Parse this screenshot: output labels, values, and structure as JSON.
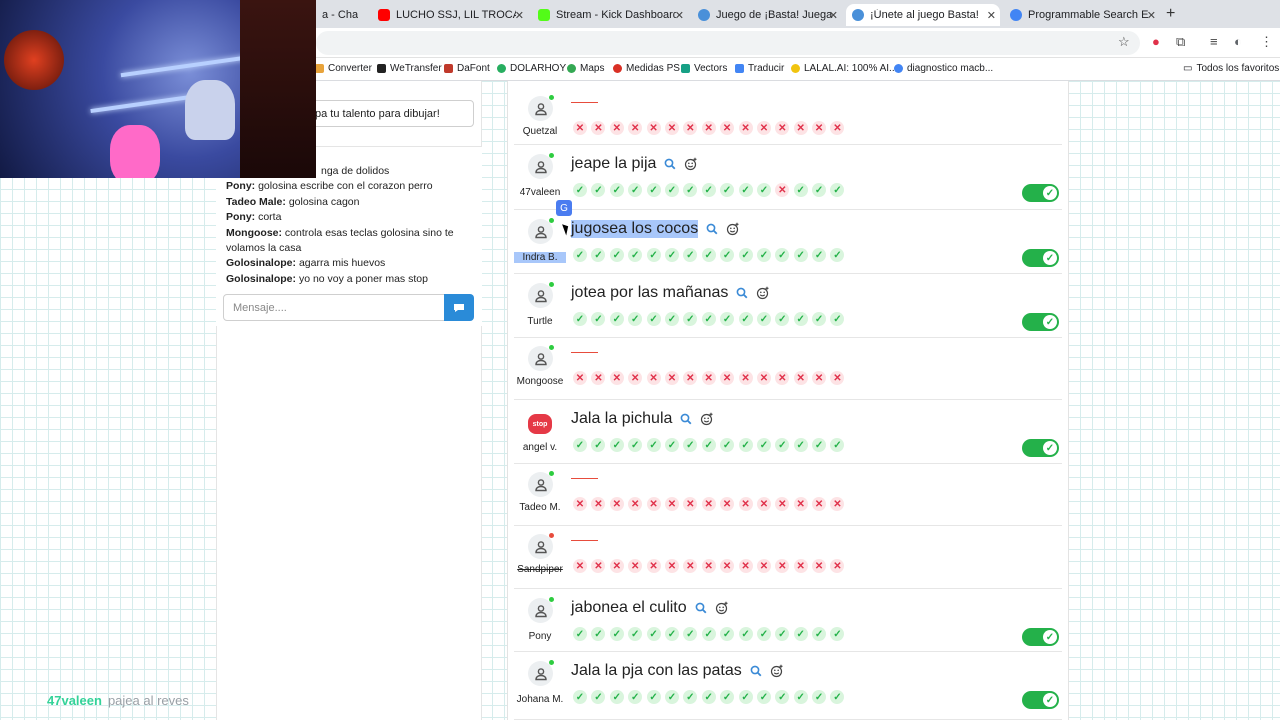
{
  "browser": {
    "tabs": [
      {
        "title": "a - Cha",
        "fav_color": "#6e6e6e"
      },
      {
        "title": "LUCHO SSJ, LIL TROCA, SIX",
        "fav_color": "#ff0000"
      },
      {
        "title": "Stream - Kick Dashboard",
        "fav_color": "#53fc18"
      },
      {
        "title": "Juego de ¡Basta! Juega Stop",
        "fav_color": "#4a90d9"
      },
      {
        "title": "¡Únete al juego Basta!",
        "fav_color": "#4a90d9"
      },
      {
        "title": "Programmable Search Engine",
        "fav_color": "#4285f4"
      }
    ],
    "new_tab": "+",
    "bookmarks": [
      {
        "label": "Converter",
        "color": "#e8a33b"
      },
      {
        "label": "WeTransfer",
        "color": "#222222"
      },
      {
        "label": "DaFont",
        "color": "#c0392b"
      },
      {
        "label": "DOLARHOY",
        "color": "#27ae60"
      },
      {
        "label": "Maps",
        "color": "#34a853"
      },
      {
        "label": "Medidas PS",
        "color": "#d93025"
      },
      {
        "label": "Vectors",
        "color": "#16a085"
      },
      {
        "label": "Traducir",
        "color": "#4285f4"
      },
      {
        "label": "LALAL.AI: 100% AI...",
        "color": "#f1c40f"
      },
      {
        "label": "diagnostico macb...",
        "color": "#4285f4"
      }
    ],
    "favorites_folder": "Todos los favoritos"
  },
  "chat": {
    "talent_button": "pa tu talento para dibujar!",
    "partial_line": "nga de dolidos",
    "messages": [
      {
        "user": "Pony:",
        "text": "golosina escribe con el corazon perro"
      },
      {
        "user": "Tadeo Male:",
        "text": "golosina cagon"
      },
      {
        "user": "Pony:",
        "text": "corta"
      },
      {
        "user": "Mongoose:",
        "text": "controla esas teclas golosina sino te volamos la casa"
      },
      {
        "user": "Golosinalope:",
        "text": "agarra mis huevos"
      },
      {
        "user": "Golosinalope:",
        "text": "yo no voy a poner mas stop"
      }
    ],
    "input_placeholder": "Mensaje...."
  },
  "players": [
    {
      "name": "Quetzal",
      "answer": "",
      "status": "online",
      "marks": "xxxxxxxxxxxxxxx",
      "toggle": false
    },
    {
      "name": "47valeen",
      "answer": "jeape la pija",
      "status": "online",
      "marks": "vvvvvvvvvvvxvvv",
      "toggle": true
    },
    {
      "name": "Indra B.",
      "answer": "jugosea los cocos",
      "status": "online",
      "marks": "vvvvvvvvvvvvvvv",
      "toggle": true,
      "highlight": true
    },
    {
      "name": "Turtle",
      "answer": "jotea por las mañanas",
      "status": "online",
      "marks": "vvvvvvvvvvvvvvv",
      "toggle": true
    },
    {
      "name": "Mongoose",
      "answer": "",
      "status": "online",
      "marks": "xxxxxxxxxxxxxxx",
      "toggle": false
    },
    {
      "name": "angel v.",
      "answer": "Jala la pichula",
      "status": "stop",
      "marks": "vvvvvvvvvvvvvvv",
      "toggle": true
    },
    {
      "name": "Tadeo M.",
      "answer": "",
      "status": "online",
      "marks": "xxxxxxxxxxxxxxx",
      "toggle": false
    },
    {
      "name": "Sandpiper",
      "answer": "",
      "status": "offline",
      "marks": "xxxxxxxxxxxxxxx",
      "toggle": false,
      "strike": true
    },
    {
      "name": "Pony",
      "answer": "jabonea el culito",
      "status": "online",
      "marks": "vvvvvvvvvvvvvvv",
      "toggle": true
    },
    {
      "name": "Johana M.",
      "answer": "Jala la pja con las patas",
      "status": "online",
      "marks": "vvvvvvvvvvvvvvv",
      "toggle": true
    }
  ],
  "stop_badge": "stop",
  "overlay_caption": {
    "user": "47valeen",
    "text": "pajea al reves"
  },
  "colors": {
    "ok": "#25b24a",
    "no": "#e0314a",
    "toggle": "#24b14a",
    "accent": "#2a8bd8"
  }
}
